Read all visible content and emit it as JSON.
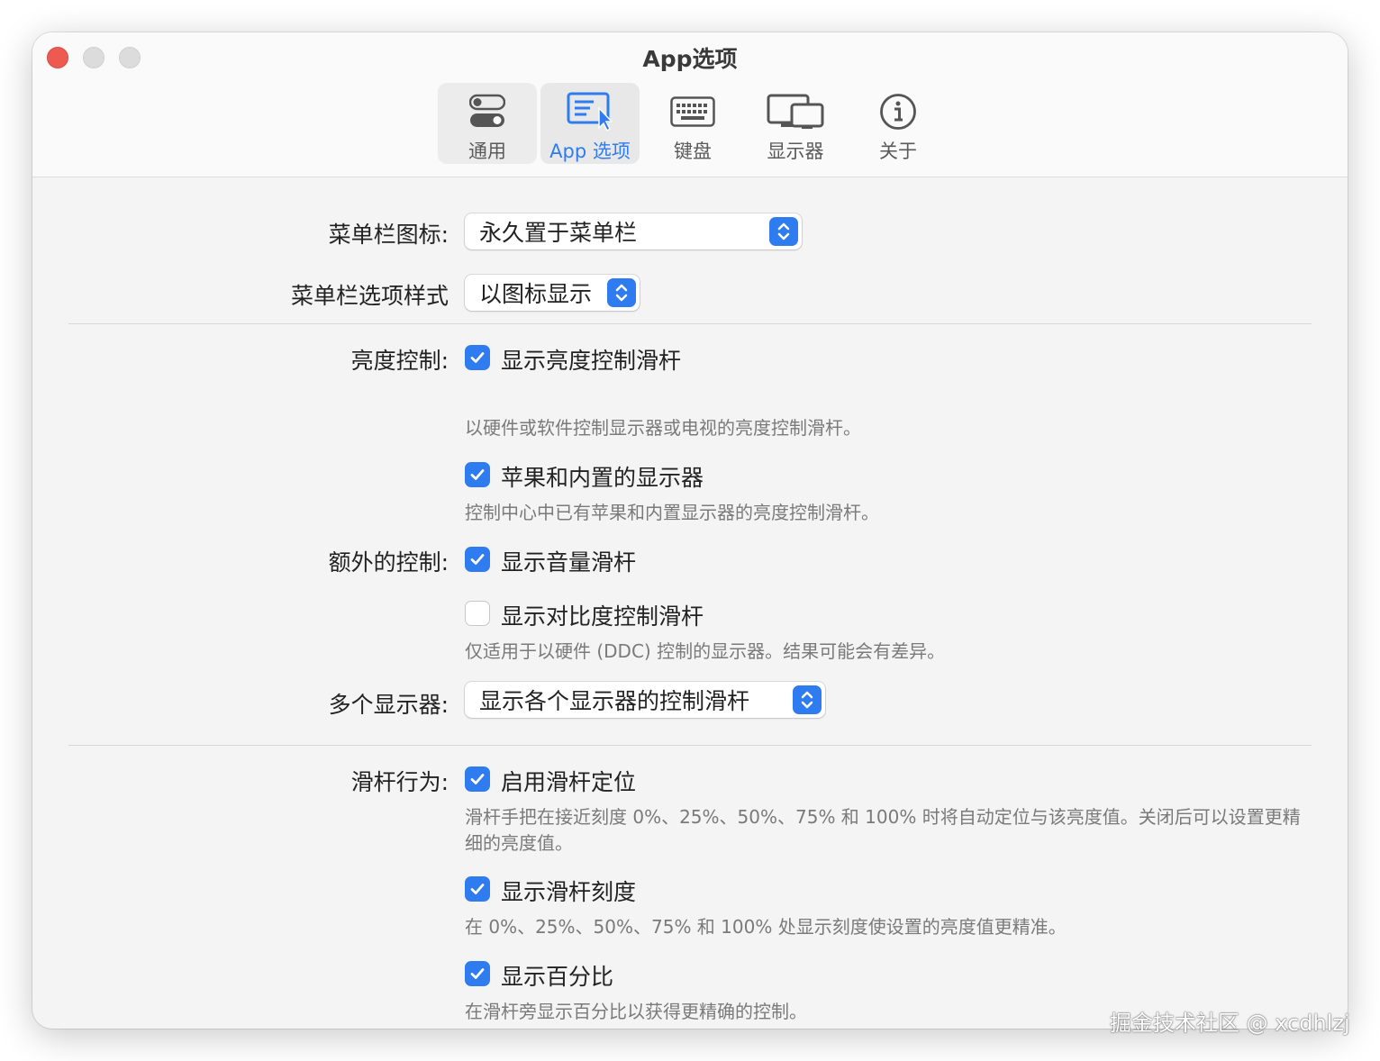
{
  "window": {
    "title": "App选项"
  },
  "toolbar": {
    "tabs": [
      {
        "label": "通用",
        "icon": "toggle-switches-icon"
      },
      {
        "label": "App 选项",
        "icon": "app-window-pointer-icon",
        "selected": true
      },
      {
        "label": "键盘",
        "icon": "keyboard-icon"
      },
      {
        "label": "显示器",
        "icon": "displays-icon"
      },
      {
        "label": "关于",
        "icon": "info-circle-icon"
      }
    ]
  },
  "menubar_icon": {
    "label": "菜单栏图标:",
    "value": "永久置于菜单栏"
  },
  "menubar_style": {
    "label": "菜单栏选项样式",
    "value": "以图标显示"
  },
  "brightness": {
    "label": "亮度控制:",
    "show_slider": {
      "label": "显示亮度控制滑杆",
      "checked": true,
      "desc": "以硬件或软件控制显示器或电视的亮度控制滑杆。"
    },
    "apple_builtin": {
      "label": "苹果和内置的显示器",
      "checked": true,
      "desc": "控制中心中已有苹果和内置显示器的亮度控制滑杆。"
    }
  },
  "extra": {
    "label": "额外的控制:",
    "volume": {
      "label": "显示音量滑杆",
      "checked": true
    },
    "contrast": {
      "label": "显示对比度控制滑杆",
      "checked": false,
      "desc": "仅适用于以硬件 (DDC) 控制的显示器。结果可能会有差异。"
    }
  },
  "multi_display": {
    "label": "多个显示器:",
    "value": "显示各个显示器的控制滑杆"
  },
  "slider_behavior": {
    "label": "滑杆行为:",
    "snapping": {
      "label": "启用滑杆定位",
      "checked": true,
      "desc": "滑杆手把在接近刻度 0%、25%、50%、75% 和 100% 时将自动定位与该亮度值。关闭后可以设置更精细的亮度值。"
    },
    "ticks": {
      "label": "显示滑杆刻度",
      "checked": true,
      "desc": "在 0%、25%、50%、75% 和 100% 处显示刻度使设置的亮度值更精准。"
    },
    "percent": {
      "label": "显示百分比",
      "checked": true,
      "desc": "在滑杆旁显示百分比以获得更精确的控制。"
    }
  },
  "watermark": "掘金技术社区 @ xcdhlzj",
  "colors": {
    "accent": "#2f7bf0",
    "close": "#ee5a52",
    "window_bg": "#f4f4f4"
  }
}
